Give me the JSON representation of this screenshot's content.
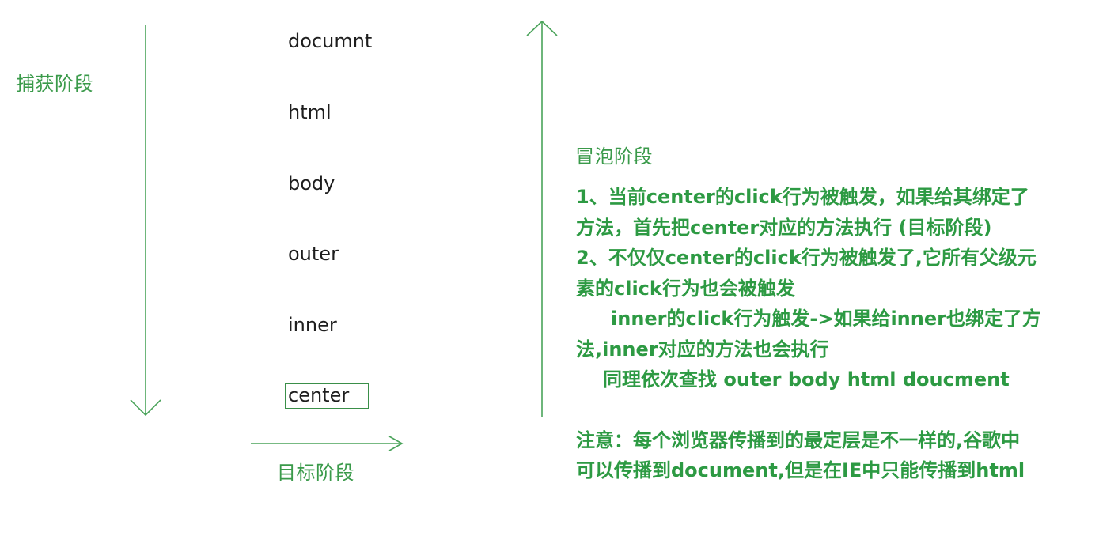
{
  "labels": {
    "capture": "捕获阶段",
    "bubble": "冒泡阶段",
    "target": "目标阶段"
  },
  "nodes": [
    "documnt",
    "html",
    "body",
    "outer",
    "inner",
    "center"
  ],
  "notes": {
    "line1": "1、当前center的click行为被触发，如果给其绑定了",
    "line2": "方法，首先把center对应的方法执行 (目标阶段)",
    "line3": "2、不仅仅center的click行为被触发了,它所有父级元",
    "line4": "素的click行为也会被触发",
    "line5": "inner的click行为触发->如果给inner也绑定了方",
    "line6": "法,inner对应的方法也会执行",
    "line7": "同理依次查找 outer body html doucment",
    "line8": "注意：每个浏览器传播到的最定层是不一样的,谷歌中",
    "line9": "可以传播到document,但是在IE中只能传播到html"
  },
  "colors": {
    "line": "#4aa35a",
    "label": "#3a9a4a",
    "notes": "#2d9a43",
    "node_text": "#1e1e1e"
  }
}
